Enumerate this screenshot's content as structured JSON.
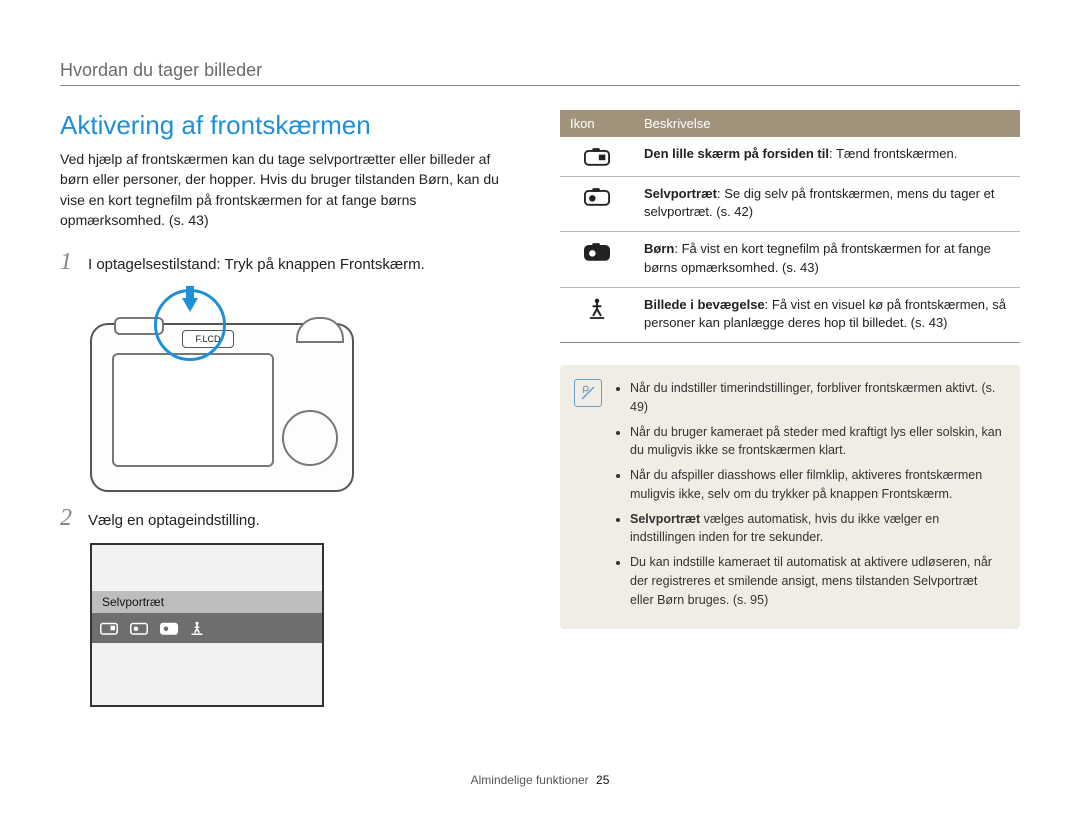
{
  "section_header": "Hvordan du tager billeder",
  "heading": "Aktivering af frontskærmen",
  "intro": "Ved hjælp af frontskærmen kan du tage selvportrætter eller billeder af børn eller personer, der hopper. Hvis du bruger tilstanden Børn, kan du vise en kort tegnefilm på frontskærmen for at fange børns opmærksomhed. (s. 43)",
  "steps": [
    {
      "num": "1",
      "text": "I optagelsestilstand: Tryk på knappen Frontskærm."
    },
    {
      "num": "2",
      "text": "Vælg en optageindstilling."
    }
  ],
  "camera_button_label": "F.LCD",
  "screen_mode_label": "Selvportræt",
  "table": {
    "headers": {
      "icon": "Ikon",
      "desc": "Beskrivelse"
    },
    "rows": [
      {
        "icon": "camera-front-on-icon",
        "bold": "Den lille skærm på forsiden til",
        "rest": ": Tænd frontskærmen."
      },
      {
        "icon": "camera-self-icon",
        "bold": "Selvportræt",
        "rest": ": Se dig selv på frontskærmen, mens du tager et selvportræt. (s. 42)"
      },
      {
        "icon": "camera-children-icon",
        "bold": "Børn",
        "rest": ": Få vist en kort tegnefilm på frontskærmen for at fange børns opmærksomhed. (s. 43)"
      },
      {
        "icon": "jump-icon",
        "bold": "Billede i bevægelse",
        "rest": ": Få vist en visuel kø på frontskærmen, så personer kan planlægge deres hop til billedet. (s. 43)"
      }
    ]
  },
  "note": {
    "items": [
      "Når du indstiller timerindstillinger, forbliver frontskærmen aktivt. (s. 49)",
      "Når du bruger kameraet på steder med kraftigt lys eller solskin, kan du muligvis ikke se frontskærmen klart.",
      "Når du afspiller diasshows eller filmklip, aktiveres frontskærmen muligvis ikke, selv om du trykker på knappen Frontskærm.",
      {
        "bold": "Selvportræt",
        "rest": " vælges automatisk, hvis du ikke vælger en indstillingen inden for tre sekunder."
      },
      "Du kan indstille kameraet til automatisk at aktivere udløseren, når der registreres et smilende ansigt, mens tilstanden Selvportræt eller Børn bruges. (s. 95)"
    ]
  },
  "footer": {
    "label": "Almindelige funktioner",
    "page": "25"
  }
}
